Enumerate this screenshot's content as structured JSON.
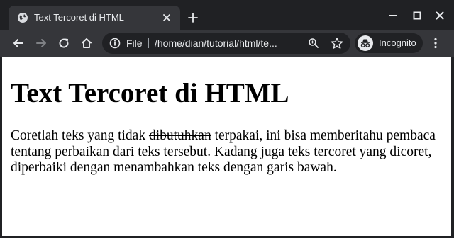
{
  "tab": {
    "title": "Text Tercoret di HTML",
    "icon": "globe-icon"
  },
  "toolbar": {
    "scheme_label": "File",
    "url": "/home/dian/tutorial/html/te...",
    "profile_label": "Incognito"
  },
  "content": {
    "heading": "Text Tercoret di HTML",
    "p_1": "Coretlah teks yang tidak ",
    "p_strike_1": "dibutuhkan",
    "p_2": " terpakai, ini bisa memberitahu pembaca tentang perbaikan dari teks tersebut. Kadang juga teks ",
    "p_strike_2": "tercoret",
    "p_3": " ",
    "p_underline": "yang dicoret",
    "p_4": ", diperbaiki dengan menambahkan teks dengan garis bawah."
  },
  "colors": {
    "frame": "#202124",
    "toolbar": "#35363a",
    "text_light": "#e8eaed",
    "icon_light": "#dadce0",
    "page_bg": "#ffffff"
  }
}
